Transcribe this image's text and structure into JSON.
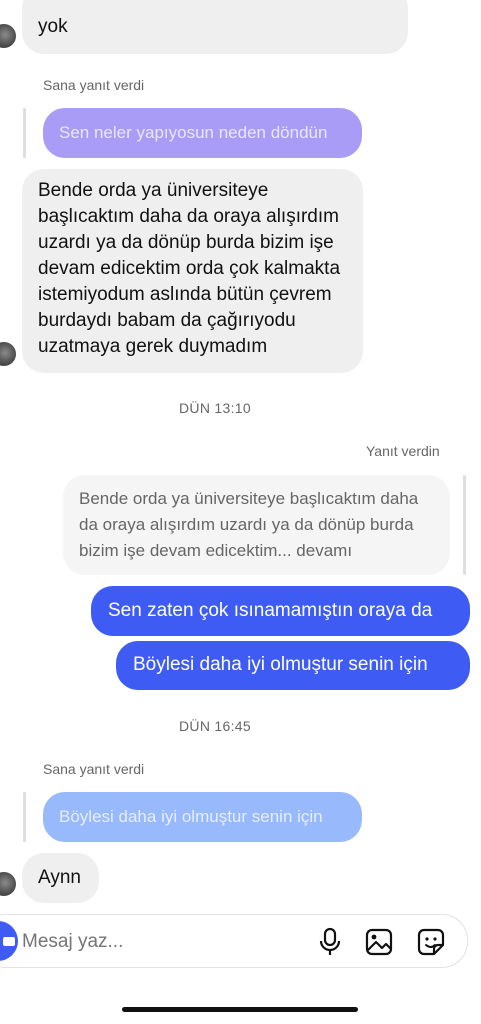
{
  "conversation": {
    "top_message": {
      "text": "yok"
    },
    "reply_1": {
      "label": "Sana yanıt verdi",
      "quoted_text": "Sen neler yapıyosun neden döndün",
      "message": "Bende orda ya üniversiteye başlıcaktım daha da oraya alışırdım uzardı ya da dönüp burda bizim işe devam edicektim orda çok kalmakta istemiyodum aslında bütün çevrem burdaydı babam da çağırıyodu uzatmaya gerek duymadım"
    },
    "timestamp_1": "DÜN 13:10",
    "my_reply": {
      "label": "Yanıt verdin",
      "quoted_text": "Bende orda ya üniversiteye başlıcaktım daha da oraya alışırdım uzardı ya da dönüp burda bizim işe devam edicektim... devamı",
      "messages": [
        "Sen zaten çok ısınamamıştın oraya da",
        "Böylesi daha iyi olmuştur senin için"
      ]
    },
    "timestamp_2": "DÜN 16:45",
    "reply_2": {
      "label": "Sana yanıt verdi",
      "quoted_text": "Böylesi daha iyi olmuştur senin için",
      "message": "Aynn"
    }
  },
  "composer": {
    "placeholder": "Mesaj yaz...",
    "icons": [
      "camera-icon",
      "microphone-icon",
      "gallery-icon",
      "sticker-icon"
    ]
  },
  "colors": {
    "outgoing_bubble": "#3e5cf4",
    "incoming_bubble": "#efefef",
    "quote_purple": "#a99cf6",
    "quote_light_blue": "#98b9fb"
  }
}
